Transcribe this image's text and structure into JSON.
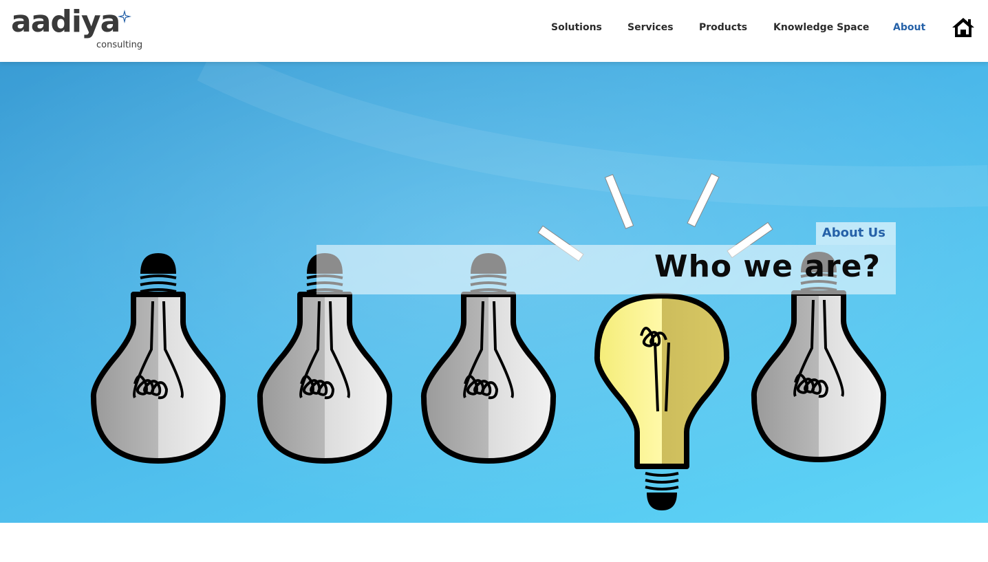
{
  "brand": {
    "name": "aadiya",
    "sub": "consulting",
    "accent": "#2561a8"
  },
  "nav": {
    "items": [
      {
        "label": "Solutions"
      },
      {
        "label": "Services"
      },
      {
        "label": "Products"
      },
      {
        "label": "Knowledge Space"
      },
      {
        "label": "About",
        "active": true
      }
    ],
    "home_icon": "home-icon"
  },
  "hero": {
    "tag": "About Us",
    "title": "Who we are?",
    "background": "light-bulbs-illustration"
  },
  "colors": {
    "text": "#2b2b2b",
    "active": "#2561a8",
    "hero_blue": "#4bb8ea",
    "bulb_yellow": "#fbf28a"
  }
}
